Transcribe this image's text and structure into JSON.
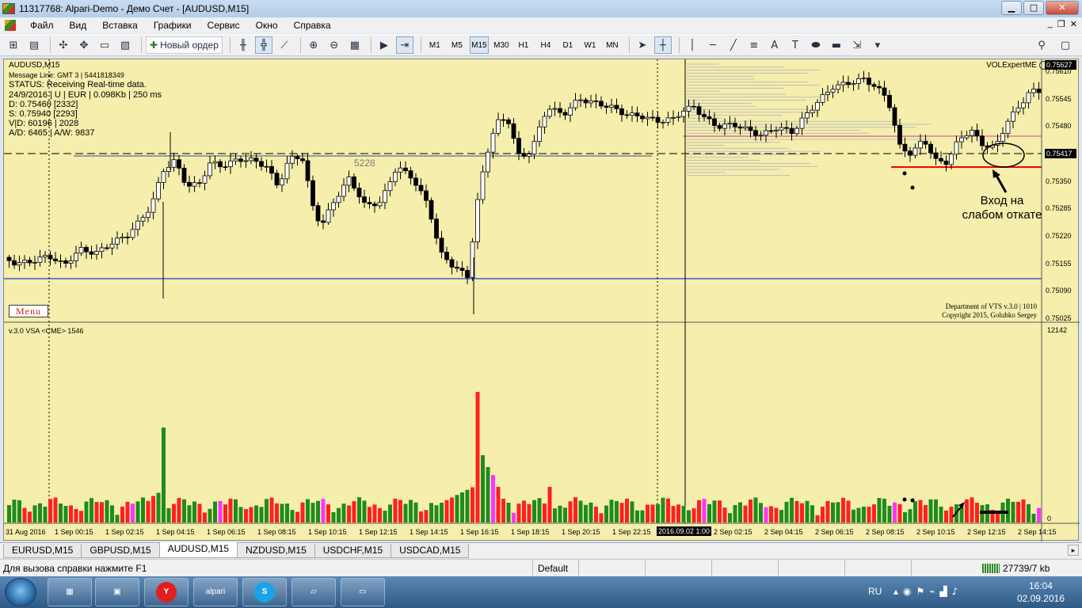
{
  "window": {
    "title": "11317768: Alpari-Demo - Демо Счет - [AUDUSD,M15]"
  },
  "menu": [
    "Файл",
    "Вид",
    "Вставка",
    "Графики",
    "Сервис",
    "Окно",
    "Справка"
  ],
  "toolbar": {
    "new_order": "Новый ордер",
    "timeframes": [
      "M1",
      "M5",
      "M15",
      "M30",
      "H1",
      "H4",
      "D1",
      "W1",
      "MN"
    ],
    "selected_timeframe": "M15"
  },
  "chart": {
    "symbol_label": "AUDUSD,M15",
    "info_lines": [
      "Message Line: GMT 3 | 5441818349",
      "STATUS:  Receiving Real-time data.",
      "24/9/2016 | U | EUR | 0.098Kb | 250 ms",
      "D: 0.75460  [2332]",
      "S: 0.75940  [2293]",
      "V|D: 60196 | 2028",
      "A/D: 6465 | A/W: 9837"
    ],
    "menu_button": "Menu",
    "level_label": "5228",
    "expert_label": "VOLExpertME",
    "copyright": [
      "Department of VTS  v.3.0 | 1010",
      "Copyright 2015, Golubko Sergey"
    ],
    "annotation": [
      "Вход на",
      "слабом откате"
    ],
    "price_axis": [
      "0.75610",
      "0.75545",
      "0.75480",
      "0.75350",
      "0.75285",
      "0.75220",
      "0.75155",
      "0.75090",
      "0.75025"
    ],
    "price_current": "0.75627",
    "price_line": "0.75417",
    "time_axis": [
      "31 Aug 2016",
      "1 Sep 00:15",
      "1 Sep 02:15",
      "1 Sep 04:15",
      "1 Sep 06:15",
      "1 Sep 08:15",
      "1 Sep 10:15",
      "1 Sep 12:15",
      "1 Sep 14:15",
      "1 Sep 16:15",
      "1 Sep 18:15",
      "1 Sep 20:15",
      "1 Sep 22:15",
      "2 Sep 02:15",
      "2 Sep 04:15",
      "2 Sep 06:15",
      "2 Sep 08:15",
      "2 Sep 10:15",
      "2 Sep 12:15",
      "2 Sep 14:15"
    ],
    "cursor_time": "2016.09.02 1:00",
    "indicator_label": "v.3.0  VSA  <CME>  1546",
    "volume_max": "12142",
    "volume_zero": "0",
    "colors": {
      "background": "#f5eeac",
      "bull": "#ffffff",
      "bear": "#000000",
      "vol_up": "#1e8c1e",
      "vol_down": "#ff2020",
      "vol_climax": "#ff33ff",
      "support": "#2040d0",
      "entry": "#ff0000"
    }
  },
  "tabs": [
    "EURUSD,M15",
    "GBPUSD,M15",
    "AUDUSD,M15",
    "NZDUSD,M15",
    "USDCHF,M15",
    "USDCAD,M15"
  ],
  "selected_tab": "AUDUSD,M15",
  "status": {
    "help": "Для вызова справки нажмите F1",
    "profile": "Default",
    "traffic": "27739/7 kb"
  },
  "taskbar": {
    "lang": "RU",
    "time": "16:04",
    "date": "02.09.2016",
    "apps": [
      "alpari"
    ]
  }
}
